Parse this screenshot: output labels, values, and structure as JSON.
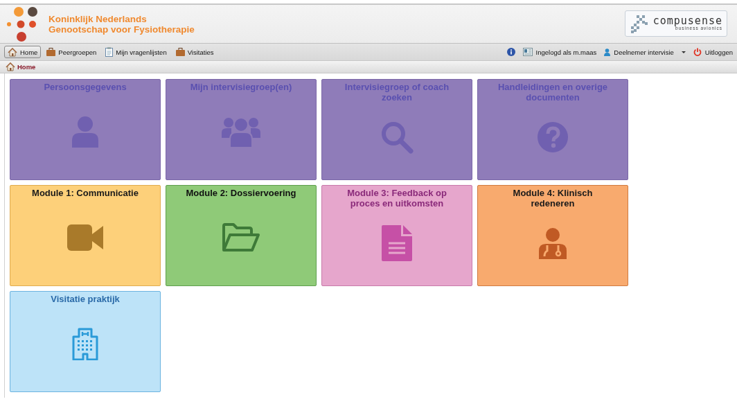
{
  "header": {
    "org_name": "Koninklijk Nederlands",
    "org_name_line2": "Genootschap voor Fysiotherapie",
    "partner_logo": {
      "name": "compusense",
      "tagline": "business avionics"
    }
  },
  "menu": {
    "items": [
      {
        "label": "Home",
        "selected": true
      },
      {
        "label": "Peergroepen",
        "selected": false
      },
      {
        "label": "Mijn vragenlijsten",
        "selected": false
      },
      {
        "label": "Visitaties",
        "selected": false
      }
    ],
    "right": [
      {
        "kind": "info"
      },
      {
        "label": "Ingelogd als m.maas",
        "kind": "text"
      },
      {
        "label": "Deelnemer intervisie",
        "kind": "dropdown"
      },
      {
        "label": "Uitloggen",
        "kind": "link"
      }
    ]
  },
  "breadcrumb": {
    "label": "Home"
  },
  "tiles": [
    {
      "title": "Persoonsgegevens",
      "color": "#8f7cb9"
    },
    {
      "title": "Mijn intervisiegroep(en)",
      "color": "#8f7cb9"
    },
    {
      "title": "Intervisiegroep of coach zoeken",
      "color": "#8f7cb9"
    },
    {
      "title": "Handleidingen en overige documenten",
      "color": "#8f7cb9"
    },
    {
      "title": "Module 1: Communicatie",
      "color": "#fdd07a"
    },
    {
      "title": "Module 2: Dossiervoering",
      "color": "#8fca78"
    },
    {
      "title": "Module 3: Feedback op proces en uitkomsten",
      "color": "#e6a6cc"
    },
    {
      "title": "Module 4: Klinisch redeneren",
      "color": "#f8aa6e"
    },
    {
      "title": "Visitatie praktijk",
      "color": "#bde3f8"
    }
  ]
}
